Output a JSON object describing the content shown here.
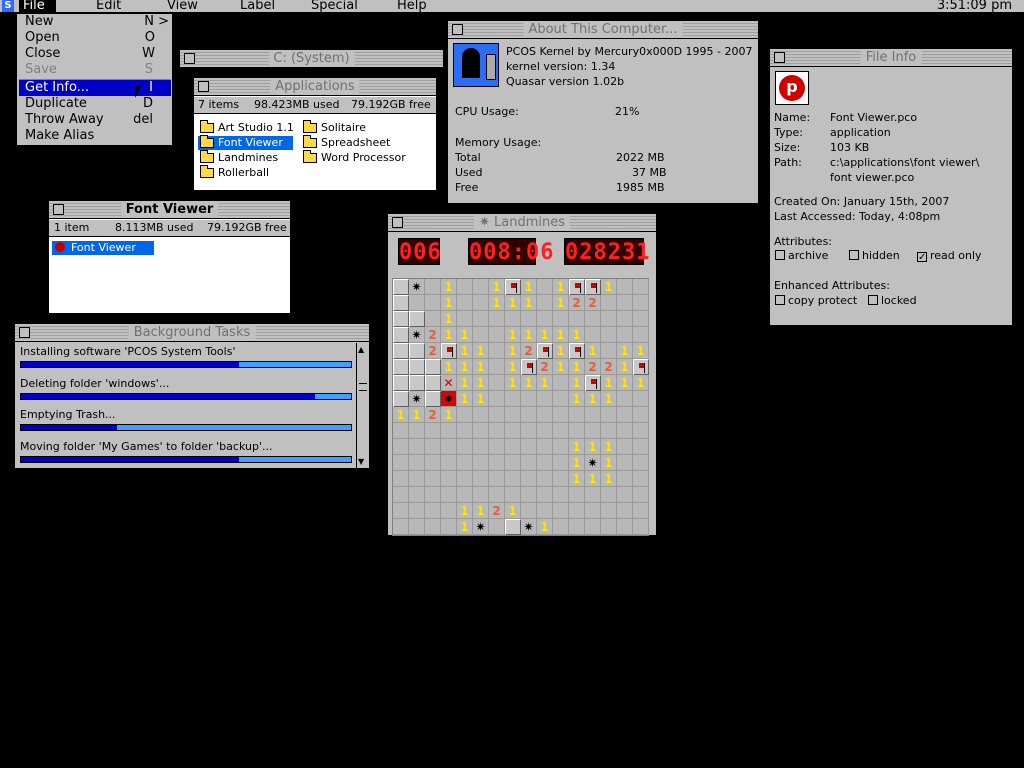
{
  "menubar": {
    "items": [
      "File",
      "Edit",
      "View",
      "Label",
      "Special",
      "Help"
    ],
    "clock": "3:51:09 pm"
  },
  "file_menu": {
    "items": [
      {
        "label": "New",
        "shortcut": "N >"
      },
      {
        "label": "Open",
        "shortcut": "O"
      },
      {
        "label": "Close",
        "shortcut": "W"
      },
      {
        "label": "Save",
        "shortcut": "S"
      },
      {
        "label": "Get Info...",
        "shortcut": "I"
      },
      {
        "label": "Duplicate",
        "shortcut": "D"
      },
      {
        "label": "Throw Away",
        "shortcut": "del"
      },
      {
        "label": "Make Alias",
        "shortcut": ""
      }
    ]
  },
  "system_window": {
    "title": "C: (System)"
  },
  "applications": {
    "title": "Applications",
    "items_count": "7 items",
    "used": "98.423MB used",
    "free": "79.192GB free",
    "files": [
      "Art Studio 1.1",
      "Font Viewer",
      "Landmines",
      "Rollerball",
      "Solitaire",
      "Spreadsheet",
      "Word Processor"
    ]
  },
  "font_viewer": {
    "title": "Font Viewer",
    "items_count": "1 item",
    "used": "8.113MB used",
    "free": "79.192GB free",
    "file": "Font Viewer"
  },
  "background_tasks": {
    "title": "Background Tasks",
    "tasks": [
      {
        "label": "Installing software 'PCOS System Tools'",
        "progress": 0.66
      },
      {
        "label": "Deleting folder 'windows'...",
        "progress": 0.89
      },
      {
        "label": "Emptying Trash...",
        "progress": 0.29
      },
      {
        "label": "Moving folder 'My Games' to folder 'backup'...",
        "progress": 0.66
      }
    ]
  },
  "about": {
    "title": "About This Computer...",
    "kernel_line": "PCOS Kernel by Mercury0x000D 1995 - 2007",
    "kernel_version": "kernel version:  1.34",
    "quasar_version": "Quasar version 1.02b",
    "cpu_label": "CPU Usage:",
    "cpu_value": "21%",
    "memory_label": "Memory Usage:",
    "total_label": "Total",
    "total_value": "2022 MB",
    "used_label": "Used",
    "used_value": "37 MB",
    "free_label": "Free",
    "free_value": "1985 MB"
  },
  "landmines": {
    "title": "Landmines",
    "mines_counter": "006",
    "time_counter": "008:06",
    "score_counter": "028231"
  },
  "file_info": {
    "title": "File Info",
    "name_label": "Name:",
    "name_value": "Font Viewer.pco",
    "type_label": "Type:",
    "type_value": "application",
    "size_label": "Size:",
    "size_value": "103 KB",
    "path_label": "Path:",
    "path_value_1": "c:\\applications\\font viewer\\",
    "path_value_2": "font viewer.pco",
    "created": "Created On: January 15th, 2007",
    "accessed": "Last Accessed: Today, 4:08pm",
    "attributes_label": "Attributes:",
    "archive": "archive",
    "hidden": "hidden",
    "read_only": "read only",
    "enhanced_label": "Enhanced Attributes:",
    "copy_protect": "copy protect",
    "locked": "locked"
  }
}
